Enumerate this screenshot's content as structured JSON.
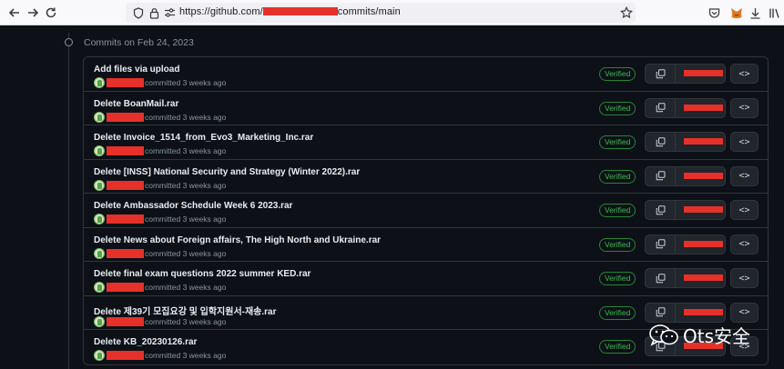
{
  "browser": {
    "url_prefix": "https://github.com/",
    "url_suffix": "commits/main",
    "icons": [
      "back-arrow-icon",
      "forward-arrow-icon",
      "reload-icon",
      "shield-icon",
      "lock-icon",
      "permissions-icon",
      "bookmark-star-icon",
      "pocket-icon",
      "metamask-fox-icon",
      "extension-icon",
      "download-icon",
      "library-icon"
    ]
  },
  "timeline": {
    "heading": "Commits on Feb 24, 2023"
  },
  "commits": [
    {
      "title": "Add files via upload",
      "meta": "committed 3 weeks ago",
      "badge": "Verified"
    },
    {
      "title": "Delete BoanMail.rar",
      "meta": "committed 3 weeks ago",
      "badge": "Verified"
    },
    {
      "title": "Delete Invoice_1514_from_Evo3_Marketing_Inc.rar",
      "meta": "committed 3 weeks ago",
      "badge": "Verified"
    },
    {
      "title": "Delete [INSS] National Security and Strategy (Winter 2022).rar",
      "meta": "committed 3 weeks ago",
      "badge": "Verified"
    },
    {
      "title": "Delete Ambassador Schedule Week 6 2023.rar",
      "meta": "committed 3 weeks ago",
      "badge": "Verified"
    },
    {
      "title": "Delete News about Foreign affairs, The High North and Ukraine.rar",
      "meta": "committed 3 weeks ago",
      "badge": "Verified"
    },
    {
      "title": "Delete final exam questions 2022 summer KED.rar",
      "meta": "committed 3 weeks ago",
      "badge": "Verified"
    },
    {
      "title": "Delete 제39기 모집요강 및 입학지원서-재송.rar",
      "meta": "committed 3 weeks ago",
      "badge": "Verified"
    },
    {
      "title": "Delete KB_20230126.rar",
      "meta": "committed 3 weeks ago",
      "badge": "Verified"
    }
  ],
  "browse_label": "<>",
  "watermark": {
    "text": "Ots安全"
  },
  "colors": {
    "background": "#0d1117",
    "border": "#30363d",
    "verified": "#3fb950",
    "redaction": "#e5312a"
  }
}
